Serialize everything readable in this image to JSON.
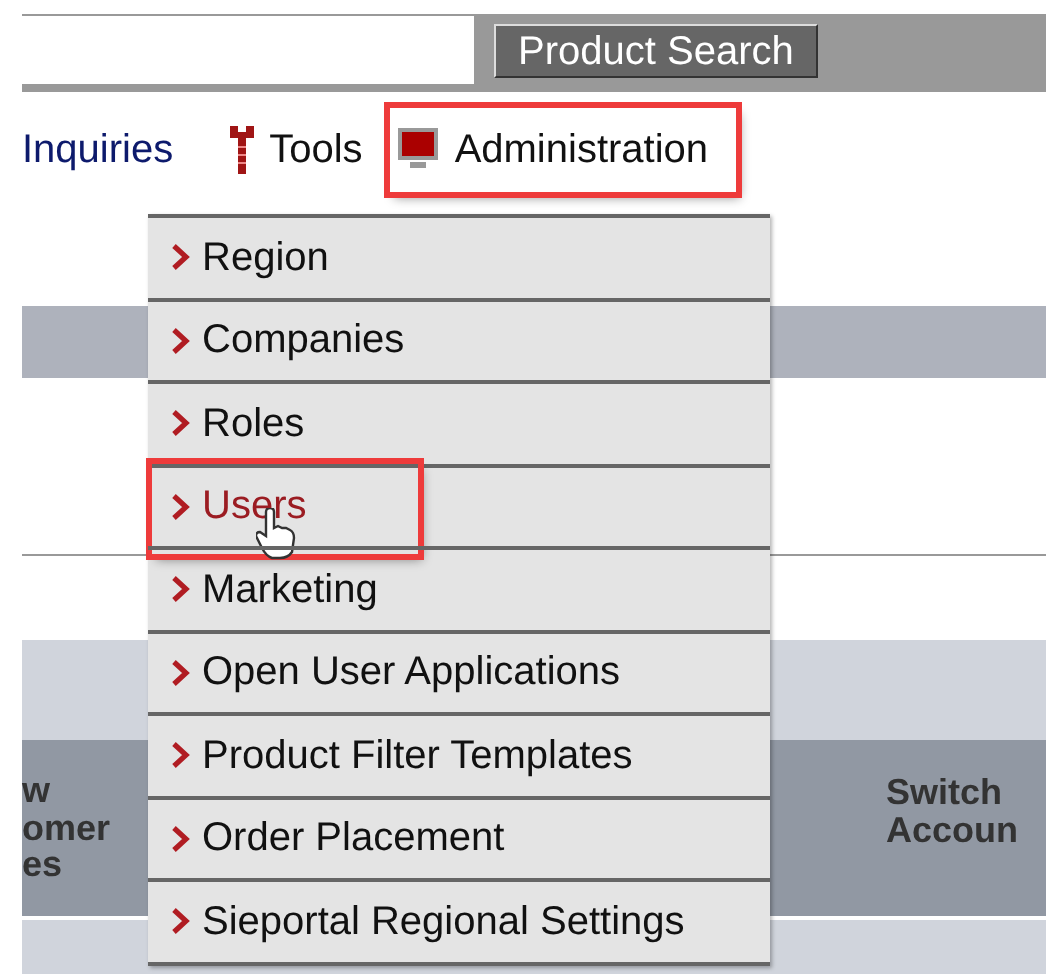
{
  "search_button": "Product Search",
  "nav": [
    {
      "label": "Inquiries",
      "kind": "text",
      "annotated": false
    },
    {
      "label": "Tools",
      "kind": "wrench",
      "annotated": false
    },
    {
      "label": "Administration",
      "kind": "monitor",
      "annotated": true
    }
  ],
  "admin_menu": [
    {
      "label": "Region",
      "hovered": false,
      "annotated": false
    },
    {
      "label": "Companies",
      "hovered": false,
      "annotated": false
    },
    {
      "label": "Roles",
      "hovered": false,
      "annotated": false
    },
    {
      "label": "Users",
      "hovered": true,
      "annotated": true
    },
    {
      "label": "Marketing",
      "hovered": false,
      "annotated": false
    },
    {
      "label": "Open User Applications",
      "hovered": false,
      "annotated": false
    },
    {
      "label": "Product Filter Templates",
      "hovered": false,
      "annotated": false
    },
    {
      "label": "Order Placement",
      "hovered": false,
      "annotated": false
    },
    {
      "label": "Sieportal Regional Settings",
      "hovered": false,
      "annotated": false
    }
  ],
  "table": {
    "columns": [
      "w\nomer\nes",
      "Switch\nAccoun"
    ]
  }
}
